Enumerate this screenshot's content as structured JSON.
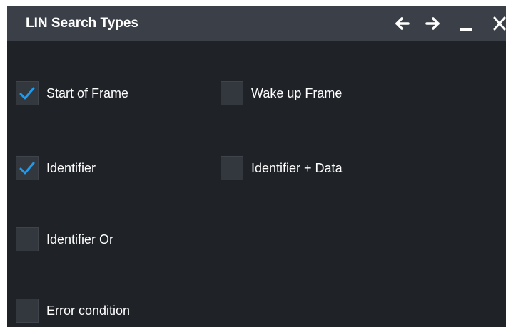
{
  "dialog": {
    "title": "LIN Search Types",
    "buttons": {
      "back": "arrow-left-icon",
      "forward": "arrow-right-icon",
      "minimize": "minimize-icon",
      "close": "close-icon"
    }
  },
  "options": [
    {
      "label": "Start of Frame",
      "checked": true
    },
    {
      "label": "Wake up Frame",
      "checked": false
    },
    {
      "label": "Identifier",
      "checked": true
    },
    {
      "label": "Identifier + Data",
      "checked": false
    },
    {
      "label": "Identifier Or",
      "checked": false
    },
    {
      "label": "Error condition",
      "checked": false
    }
  ],
  "colors": {
    "accent_check": "#1e9cf0",
    "titlebar": "#3b4048",
    "background": "#1f2227"
  }
}
